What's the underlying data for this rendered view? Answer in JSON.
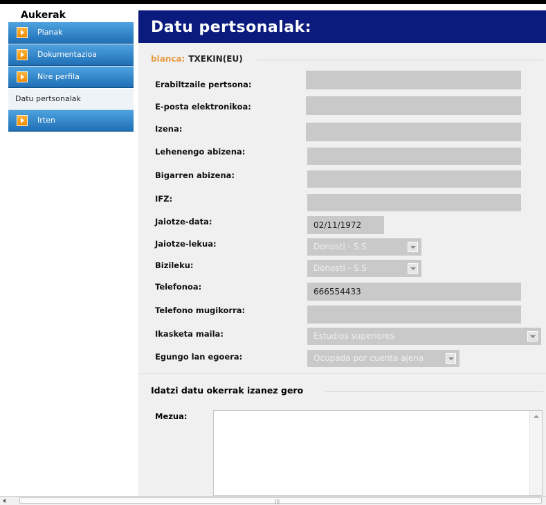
{
  "sidebar": {
    "title": "Aukerak",
    "items": [
      {
        "label": "Planak"
      },
      {
        "label": "Dokumentazioa"
      },
      {
        "label": "Nire perfila"
      },
      {
        "label": "Datu pertsonalak"
      },
      {
        "label": "Irten"
      }
    ]
  },
  "header": {
    "title": "Datu pertsonalak:"
  },
  "user": {
    "name": "blanca:",
    "code": "TXEKIN(EU)"
  },
  "form": {
    "fields": [
      {
        "label": "Erabiltzaile pertsona:",
        "value": ""
      },
      {
        "label": "E-posta elektronikoa:",
        "value": ""
      },
      {
        "label": "Izena:",
        "value": ""
      },
      {
        "label": "Lehenengo abizena:",
        "value": ""
      },
      {
        "label": "Bigarren abizena:",
        "value": ""
      },
      {
        "label": "IFZ:",
        "value": ""
      },
      {
        "label": "Jaiotze-data:",
        "value": "02/11/1972"
      },
      {
        "label": "Jaiotze-lekua:",
        "value": "Donosti - S.S"
      },
      {
        "label": "Bizileku:",
        "value": "Donosti - S.S"
      },
      {
        "label": "Telefonoa:",
        "value": "666554433"
      },
      {
        "label": "Telefono mugikorra:",
        "value": ""
      },
      {
        "label": "Ikasketa maila:",
        "value": "Estudios superiores"
      },
      {
        "label": "Egungo lan egoera:",
        "value": "Ocupada por cuenta ajena"
      }
    ]
  },
  "message_section": {
    "title": "Idatzi datu okerrak izanez gero",
    "message_label": "Mezua:",
    "message_value": ""
  },
  "icons": {
    "nav_arrow": "chevron-right-icon",
    "dropdown": "chevron-down-icon",
    "scroll_up": "scroll-up-icon",
    "scroll_left": "scroll-left-icon"
  },
  "colors": {
    "header_bg": "#0a1a7d",
    "nav_bg": "#2f86cc",
    "nav_arrow": "#f59a16",
    "user_name": "#e59c45",
    "field_bg": "#c9c9c9"
  }
}
